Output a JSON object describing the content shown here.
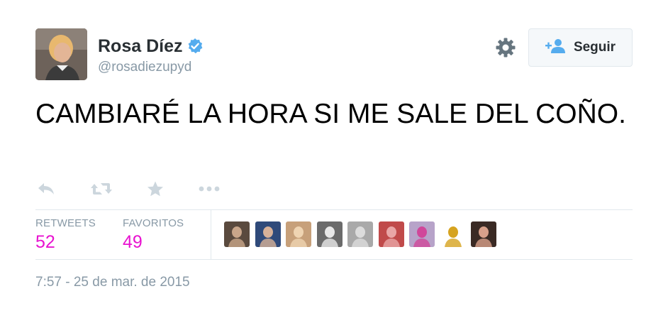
{
  "user": {
    "name": "Rosa Díez",
    "handle": "@rosadiezupyd",
    "verified": true
  },
  "follow_button": {
    "label": "Seguir"
  },
  "tweet": {
    "text": "CAMBIARÉ LA HORA SI ME SALE DEL COÑO."
  },
  "actions": [
    "reply-icon",
    "retweet-icon",
    "favorite-icon",
    "more-icon"
  ],
  "stats": {
    "retweets_label": "RETWEETS",
    "retweets_count": "52",
    "favorites_label": "FAVORITOS",
    "favorites_count": "49"
  },
  "favoriters": [
    {
      "name": "favoriter-avatar-1",
      "bg": "#5a4a3e",
      "fg": "#c9a68a"
    },
    {
      "name": "favoriter-avatar-2",
      "bg": "#2f4a7a",
      "fg": "#d7b199"
    },
    {
      "name": "favoriter-avatar-3",
      "bg": "#c7a07a",
      "fg": "#efd4b2"
    },
    {
      "name": "favoriter-avatar-4",
      "bg": "#6b6b6b",
      "fg": "#e8e8e8"
    },
    {
      "name": "favoriter-avatar-5",
      "bg": "#a9a9a9",
      "fg": "#dcdcdc"
    },
    {
      "name": "favoriter-avatar-6",
      "bg": "#c04a4a",
      "fg": "#e9a6a6"
    },
    {
      "name": "favoriter-avatar-7",
      "bg": "#b7a3c9",
      "fg": "#d0479a"
    },
    {
      "name": "favoriter-avatar-8",
      "bg": "#ffffff",
      "fg": "#d6a31f"
    },
    {
      "name": "favoriter-avatar-9",
      "bg": "#3a2a24",
      "fg": "#d8a08a"
    }
  ],
  "timestamp": "7:57 - 25 de mar. de 2015",
  "colors": {
    "count_accent": "#e813d0",
    "verified_blue": "#55acee",
    "icon_gray": "#8899a6",
    "action_gray": "#ccd6dd"
  }
}
